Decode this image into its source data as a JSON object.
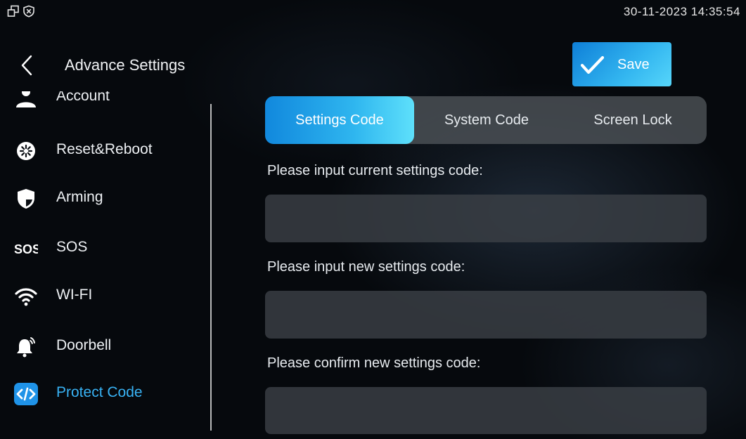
{
  "statusbar": {
    "datetime": "30-11-2023 14:35:54",
    "icons": [
      "windows-icon",
      "shield-x-icon"
    ]
  },
  "header": {
    "back_icon": "chevron-left-icon",
    "title": "Advance Settings",
    "save_label": "Save",
    "save_icon": "checkmark-icon"
  },
  "sidebar": {
    "items": [
      {
        "label": "Account",
        "icon": "account-icon"
      },
      {
        "label": "Reset&Reboot",
        "icon": "reset-icon"
      },
      {
        "label": "Arming",
        "icon": "shield-icon"
      },
      {
        "label": "SOS",
        "icon": "sos-icon",
        "icon_text": "SOS"
      },
      {
        "label": "WI-FI",
        "icon": "wifi-icon"
      },
      {
        "label": "Doorbell",
        "icon": "bell-icon"
      },
      {
        "label": "Protect Code",
        "icon": "code-icon",
        "active": true
      }
    ]
  },
  "tabs": [
    {
      "label": "Settings Code",
      "active": true
    },
    {
      "label": "System Code",
      "active": false
    },
    {
      "label": "Screen Lock",
      "active": false
    }
  ],
  "form": {
    "current_label": "Please input current settings code:",
    "current_value": "",
    "new_label": "Please input new settings code:",
    "new_value": "",
    "confirm_label": "Please confirm new settings code:",
    "confirm_value": ""
  },
  "colors": {
    "accent": "#2fb6ef",
    "active_text": "#38b2f4",
    "background": "#06090d",
    "tab_bar": "#50555a",
    "field_bg": "#3a4046"
  }
}
